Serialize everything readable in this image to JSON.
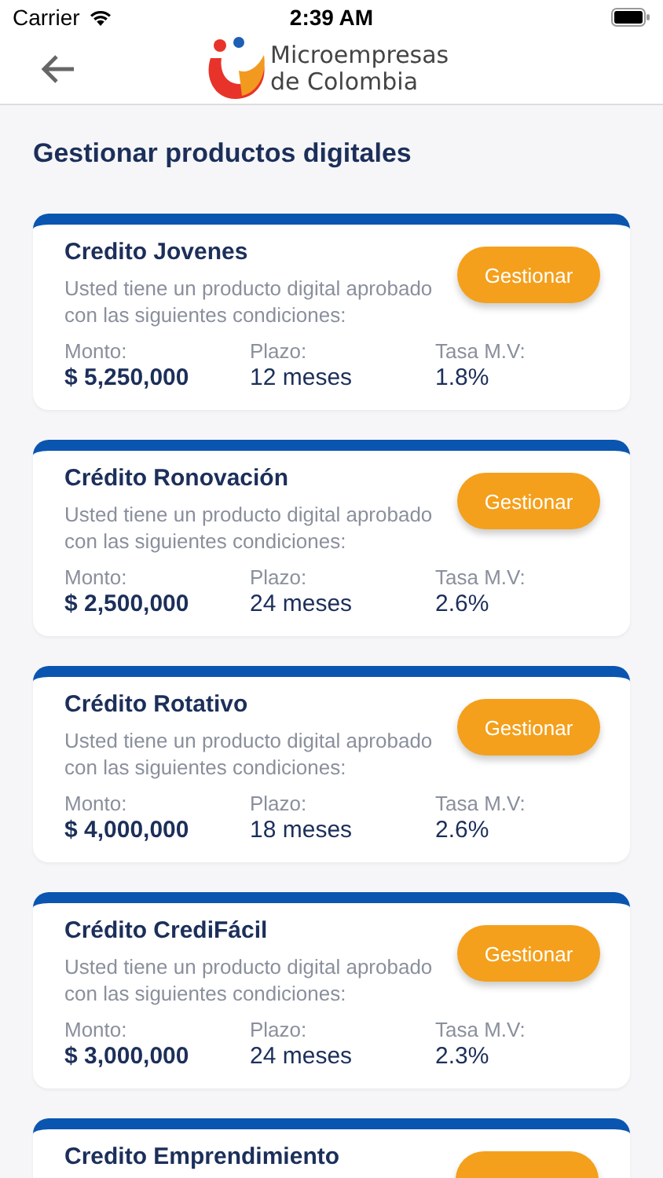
{
  "status_bar": {
    "carrier": "Carrier",
    "time": "2:39 AM"
  },
  "header": {
    "logo_line1": "Microempresas",
    "logo_line2": "de Colombia"
  },
  "page_title": "Gestionar productos digitales",
  "products": [
    {
      "name": "Credito Jovenes",
      "description": "Usted tiene un producto digital aprobado con las siguientes condiciones:",
      "button": "Gestionar",
      "fields": [
        {
          "label": "Monto:",
          "value": "$ 5,250,000",
          "bold": true
        },
        {
          "label": "Plazo:",
          "value": "12 meses",
          "bold": false
        },
        {
          "label": "Tasa M.V:",
          "value": "1.8%",
          "bold": false
        }
      ]
    },
    {
      "name": "Crédito Ronovación",
      "description": "Usted tiene un producto digital aprobado con las siguientes condiciones:",
      "button": "Gestionar",
      "fields": [
        {
          "label": "Monto:",
          "value": "$ 2,500,000",
          "bold": true
        },
        {
          "label": "Plazo:",
          "value": "24 meses",
          "bold": false
        },
        {
          "label": "Tasa M.V:",
          "value": "2.6%",
          "bold": false
        }
      ]
    },
    {
      "name": "Crédito Rotativo",
      "description": "Usted tiene un producto digital aprobado con las siguientes condiciones:",
      "button": "Gestionar",
      "fields": [
        {
          "label": "Monto:",
          "value": "$ 4,000,000",
          "bold": true
        },
        {
          "label": "Plazo:",
          "value": "18 meses",
          "bold": false
        },
        {
          "label": "Tasa M.V:",
          "value": "2.6%",
          "bold": false
        }
      ]
    },
    {
      "name": "Crédito CrediFácil",
      "description": "Usted tiene un producto digital aprobado con las siguientes condiciones:",
      "button": "Gestionar",
      "fields": [
        {
          "label": "Monto:",
          "value": "$ 3,000,000",
          "bold": true
        },
        {
          "label": "Plazo:",
          "value": "24 meses",
          "bold": false
        },
        {
          "label": "Tasa M.V:",
          "value": "2.3%",
          "bold": false
        }
      ]
    },
    {
      "name": "Credito Emprendimiento"
    }
  ]
}
